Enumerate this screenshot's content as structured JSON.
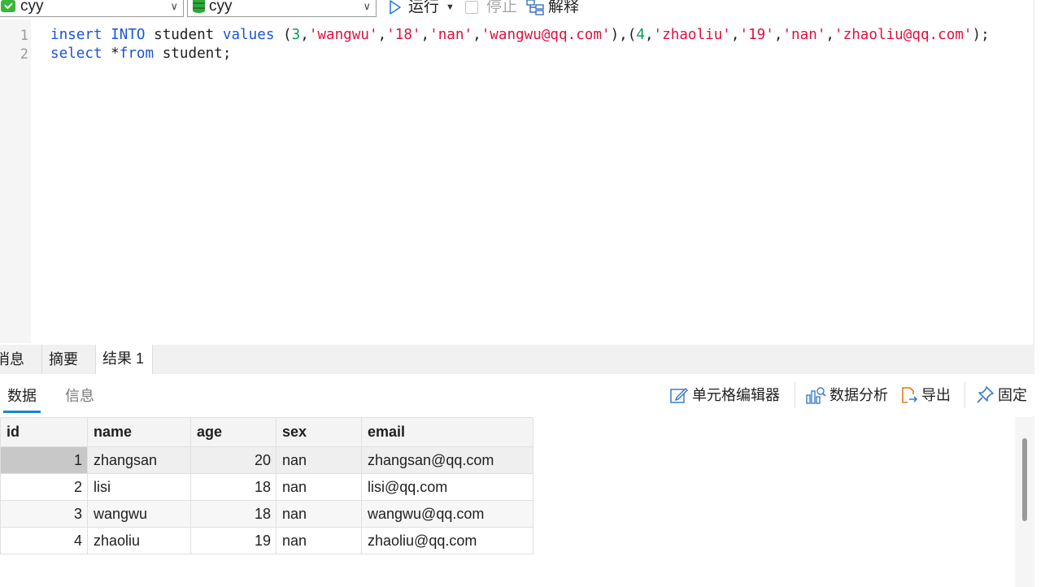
{
  "toolbar": {
    "connection": "cyy",
    "database": "cyy",
    "run_label": "运行",
    "stop_label": "停止",
    "explain_label": "解释"
  },
  "editor": {
    "line_numbers": [
      "1",
      "2"
    ],
    "line1": {
      "insert": "insert",
      "into": "INTO",
      "table": "student",
      "values": "values",
      "p1": "(",
      "n1": "3",
      "s1": "'wangwu'",
      "s2": "'18'",
      "s3": "'nan'",
      "s4": "'wangwu@qq.com'",
      "p2": "),(",
      "n2": "4",
      "s5": "'zhaoliu'",
      "s6": "'19'",
      "s7": "'nan'",
      "s8": "'zhaoliu@qq.com'",
      "p3": ");",
      "comma": ","
    },
    "line2": {
      "select": "select",
      "star": "*",
      "from": "from",
      "table": "student;"
    }
  },
  "result_tabs": [
    "消息",
    "摘要",
    "结果 1"
  ],
  "sub_tabs": {
    "data": "数据",
    "info": "信息"
  },
  "actions": {
    "cell_editor": "单元格编辑器",
    "data_analysis": "数据分析",
    "export": "导出",
    "pin": "固定"
  },
  "table": {
    "headers": [
      "id",
      "name",
      "age",
      "sex",
      "email"
    ],
    "rows": [
      [
        "1",
        "zhangsan",
        "20",
        "nan",
        "zhangsan@qq.com"
      ],
      [
        "2",
        "lisi",
        "18",
        "nan",
        "lisi@qq.com"
      ],
      [
        "3",
        "wangwu",
        "18",
        "nan",
        "wangwu@qq.com"
      ],
      [
        "4",
        "zhaoliu",
        "19",
        "nan",
        "zhaoliu@qq.com"
      ]
    ]
  },
  "colors": {
    "keyword": "#1a55d8",
    "string": "#e0113d",
    "number": "#0c9a55",
    "accent": "#1a86c8"
  }
}
